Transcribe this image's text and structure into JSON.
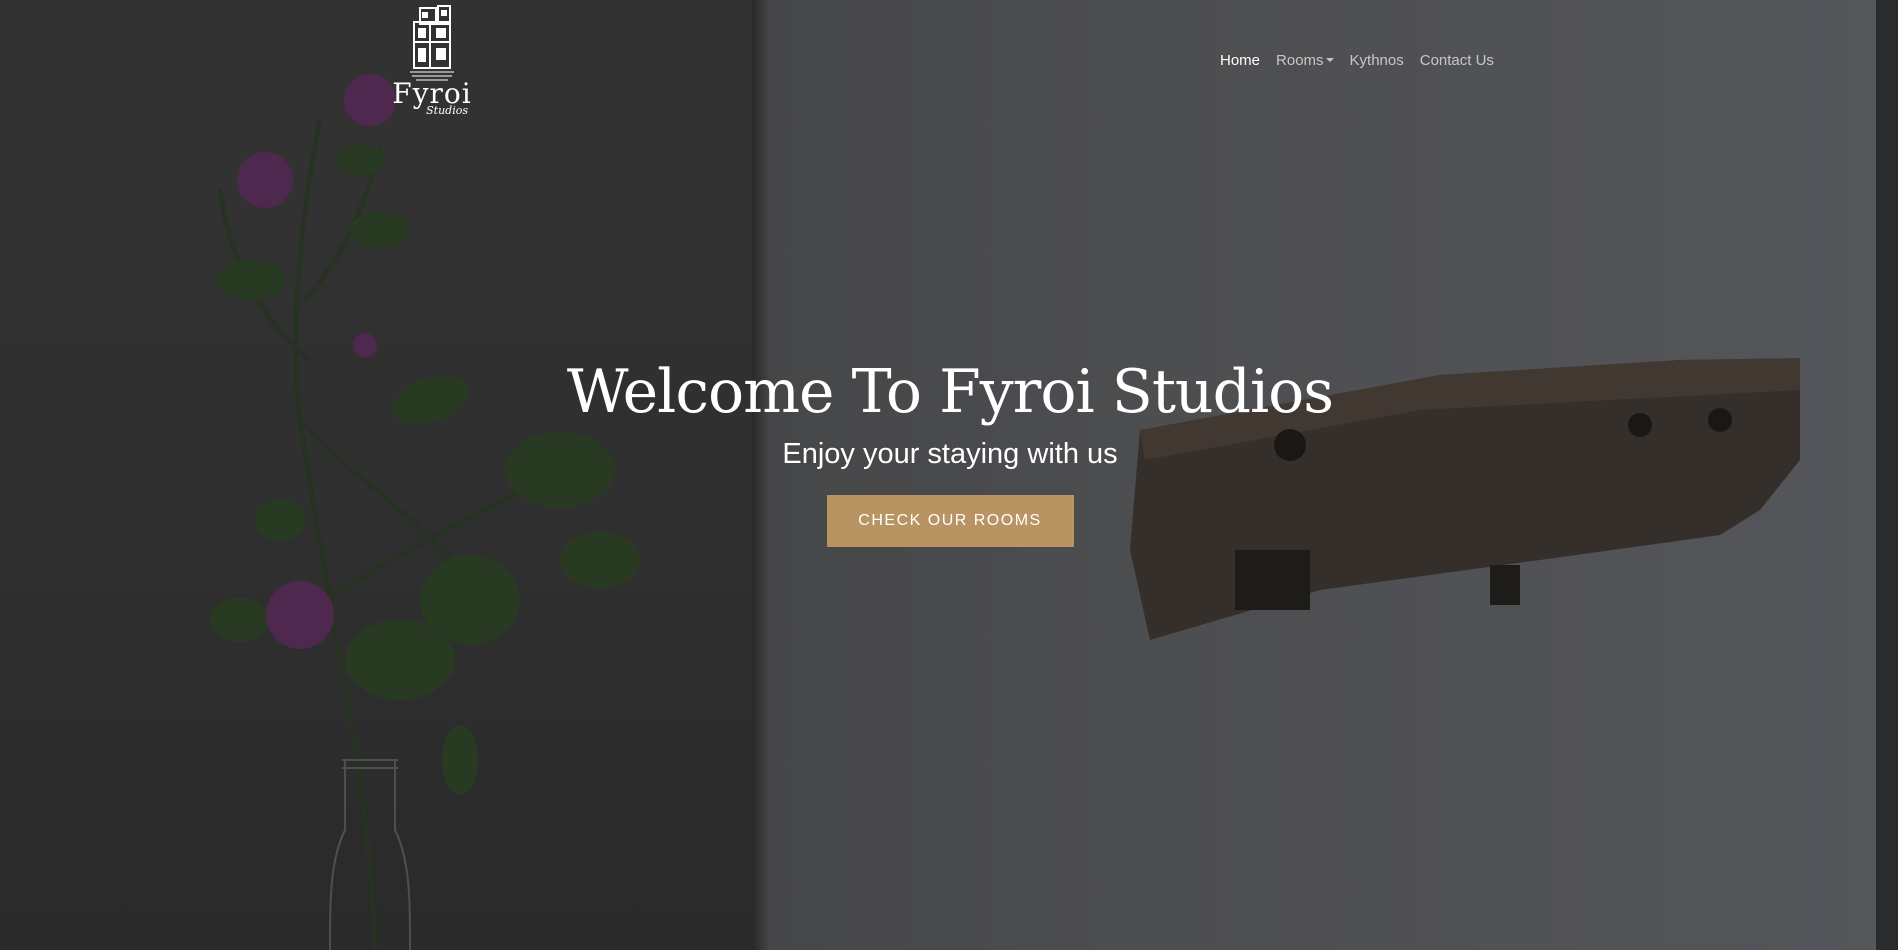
{
  "header": {
    "logo": {
      "name": "Fyroi",
      "subtitle": "Studios"
    },
    "nav": [
      {
        "label": "Home",
        "active": true
      },
      {
        "label": "Rooms",
        "has_dropdown": true
      },
      {
        "label": "Kythnos"
      },
      {
        "label": "Contact Us"
      }
    ]
  },
  "hero": {
    "title": "Welcome To Fyroi Studios",
    "subtitle": "Enjoy your staying with us",
    "cta_label": "Check Our Rooms"
  },
  "colors": {
    "accent": "#b89463",
    "nav_active": "#ffffff",
    "nav_inactive": "#ffffffad"
  }
}
